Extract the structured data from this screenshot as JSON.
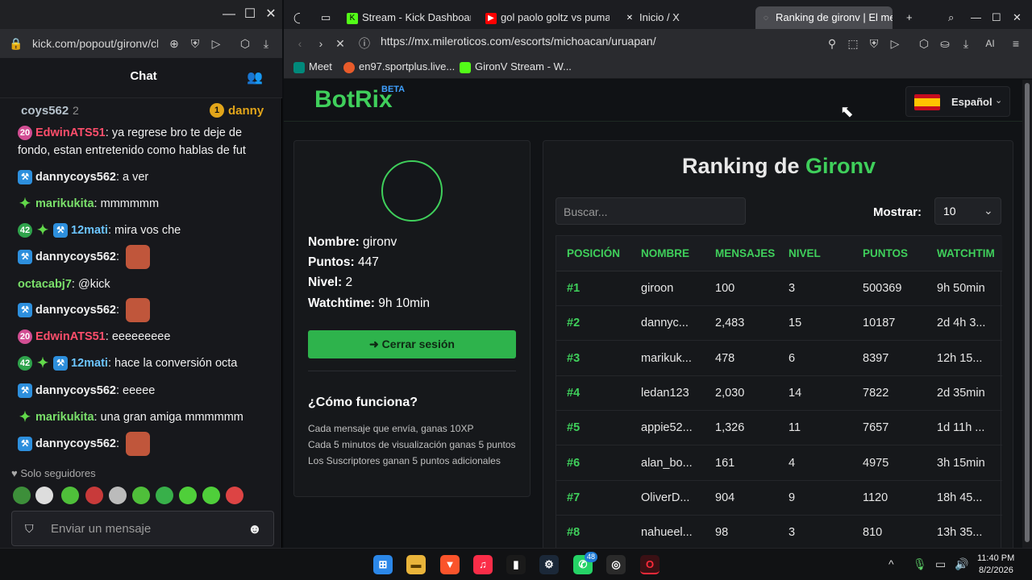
{
  "chat_window": {
    "url": "kick.com/popout/gironv/cl",
    "title": "Chat",
    "pinned": {
      "user": "coys562",
      "count": "2",
      "badge": "1",
      "user2": "danny"
    },
    "messages": [
      {
        "user": "EdwinATS51",
        "text": "ya regrese bro te deje de fondo, estan entretenido como hablas de fut",
        "badges": [
          "20"
        ],
        "color": "red"
      },
      {
        "user": "dannycoys562",
        "text": "a ver",
        "color": "blue"
      },
      {
        "user": "marikukita",
        "text": "mmmmmm",
        "color": "green"
      },
      {
        "user": "12mati",
        "text": "mira vos che",
        "badges": [
          "42"
        ],
        "color": "blue"
      },
      {
        "user": "dannycoys562",
        "text": "",
        "color": "blue",
        "emote": true
      },
      {
        "user": "octacabj7",
        "text": "@kick",
        "color": "green"
      },
      {
        "user": "dannycoys562",
        "text": "",
        "color": "blue",
        "emote": true
      },
      {
        "user": "EdwinATS51",
        "text": "eeeeeeeee",
        "badges": [
          "20"
        ],
        "color": "red"
      },
      {
        "user": "12mati",
        "text": "hace la conversión octa",
        "badges": [
          "42"
        ],
        "color": "blue"
      },
      {
        "user": "dannycoys562",
        "text": "eeeee",
        "color": "blue"
      },
      {
        "user": "marikukita",
        "text": "una gran amiga mmmmmm",
        "color": "green"
      },
      {
        "user": "dannycoys562",
        "text": "",
        "color": "blue",
        "emote": true
      }
    ],
    "followers_only": "Solo seguidores",
    "input_placeholder": "Enviar un mensaje"
  },
  "browser": {
    "tabs": [
      {
        "label": "Stream - Kick Dashboard",
        "icon": "kick-icon"
      },
      {
        "label": "gol paolo goltz vs pumas",
        "icon": "youtube-icon"
      },
      {
        "label": "Inicio / X",
        "icon": "x-icon"
      },
      {
        "label": "Ranking de gironv | El mejor",
        "icon": "loading-icon",
        "active": true
      }
    ],
    "url": "https://mx.mileroticos.com/escorts/michoacan/uruapan/",
    "bookmarks": [
      {
        "label": "Meet",
        "icon": "meet-icon"
      },
      {
        "label": "en97.sportplus.live...",
        "icon": "sportplus-icon"
      },
      {
        "label": "GironV Stream - W...",
        "icon": "kick-icon"
      }
    ]
  },
  "page": {
    "logo": "BotRix",
    "logo_badge": "BETA",
    "language": "Español",
    "profile": {
      "name_label": "Nombre:",
      "name_value": "gironv",
      "points_label": "Puntos:",
      "points_value": "447",
      "level_label": "Nivel:",
      "level_value": "2",
      "watch_label": "Watchtime:",
      "watch_value": "9h 10min",
      "logout": "Cerrar sesión",
      "how_title": "¿Cómo funciona?",
      "how_lines": [
        "Cada mensaje que envía, ganas 10XP",
        "Cada 5 minutos de visualización ganas 5 puntos",
        "Los Suscriptores ganan 5 puntos adicionales"
      ]
    },
    "ranking": {
      "title_prefix": "Ranking de",
      "title_name": "Gironv",
      "search_placeholder": "Buscar...",
      "show_label": "Mostrar:",
      "show_value": "10",
      "columns": [
        "POSICIÓN",
        "NOMBRE",
        "MENSAJES",
        "NIVEL",
        "PUNTOS",
        "WATCHTIM"
      ],
      "rows": [
        [
          "#1",
          "giroon",
          "100",
          "3",
          "500369",
          "9h 50min"
        ],
        [
          "#2",
          "dannyc...",
          "2,483",
          "15",
          "10187",
          "2d 4h 3..."
        ],
        [
          "#3",
          "marikuk...",
          "478",
          "6",
          "8397",
          "12h 15..."
        ],
        [
          "#4",
          "ledan123",
          "2,030",
          "14",
          "7822",
          "2d 35min"
        ],
        [
          "#5",
          "appie52...",
          "1,326",
          "11",
          "7657",
          "1d 11h ..."
        ],
        [
          "#6",
          "alan_bo...",
          "161",
          "4",
          "4975",
          "3h 15min"
        ],
        [
          "#7",
          "OliverD...",
          "904",
          "9",
          "1120",
          "18h 45..."
        ],
        [
          "#8",
          "nahueel...",
          "98",
          "3",
          "810",
          "13h 35..."
        ]
      ]
    }
  },
  "taskbar": {
    "time": "11:40 PM",
    "date": "8/2/2026",
    "whatsapp_badge": "48"
  },
  "colors": {
    "accent": "#3fcf5b",
    "chat_bg": "#17181c",
    "page_bg": "#111316"
  }
}
